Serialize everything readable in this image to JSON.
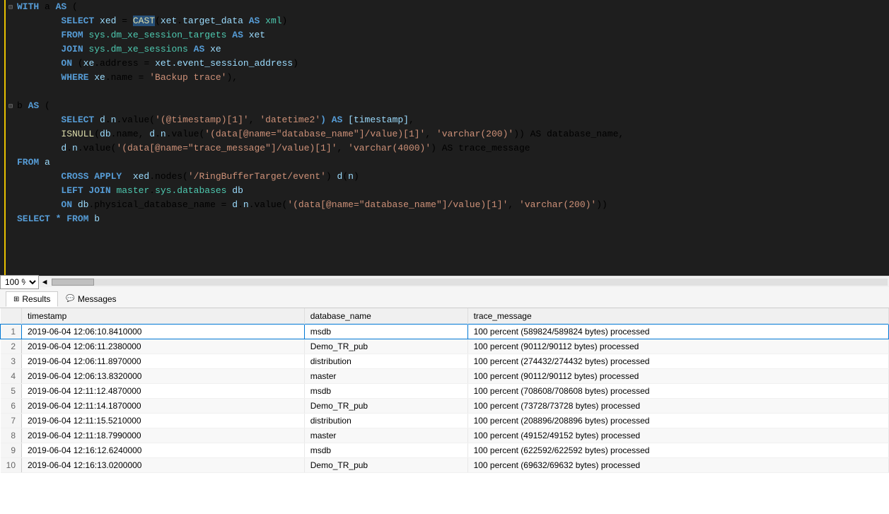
{
  "editor": {
    "lines": [
      {
        "num": "",
        "fold": "⊟",
        "content": [
          {
            "t": "WITH ",
            "c": "kw"
          },
          {
            "t": "a ",
            "c": ""
          },
          {
            "t": "AS ",
            "c": "kw"
          },
          {
            "t": "(",
            "c": ""
          }
        ]
      },
      {
        "num": "",
        "fold": "",
        "content": [
          {
            "t": "        SELECT ",
            "c": "kw"
          },
          {
            "t": "xed",
            "c": "col"
          },
          {
            "t": " = ",
            "c": ""
          },
          {
            "t": "CAST",
            "c": "fn highlight-cast"
          },
          {
            "t": "(",
            "c": ""
          },
          {
            "t": "xet",
            "c": "col"
          },
          {
            "t": ".",
            "c": ""
          },
          {
            "t": "target_data",
            "c": "col"
          },
          {
            "t": " AS ",
            "c": "kw"
          },
          {
            "t": "xml",
            "c": "type"
          },
          {
            "t": ")",
            "c": ""
          }
        ]
      },
      {
        "num": "",
        "fold": "",
        "content": [
          {
            "t": "        FROM ",
            "c": "kw"
          },
          {
            "t": "sys.dm_xe_session_targets",
            "c": "ident-green"
          },
          {
            "t": " AS ",
            "c": "kw"
          },
          {
            "t": "xet",
            "c": "col"
          }
        ]
      },
      {
        "num": "",
        "fold": "",
        "content": [
          {
            "t": "        JOIN ",
            "c": "kw"
          },
          {
            "t": "sys.dm_xe_sessions",
            "c": "ident-green"
          },
          {
            "t": " AS ",
            "c": "kw"
          },
          {
            "t": "xe",
            "c": "col"
          }
        ]
      },
      {
        "num": "",
        "fold": "",
        "content": [
          {
            "t": "        ON ",
            "c": "kw"
          },
          {
            "t": "(",
            "c": ""
          },
          {
            "t": "xe",
            "c": "col"
          },
          {
            "t": ".address = ",
            "c": ""
          },
          {
            "t": "xet",
            "c": "col"
          },
          {
            "t": ".event_session_address",
            "c": "col"
          },
          {
            "t": ")",
            "c": ""
          }
        ]
      },
      {
        "num": "",
        "fold": "",
        "content": [
          {
            "t": "        WHERE ",
            "c": "kw"
          },
          {
            "t": "xe",
            "c": "col"
          },
          {
            "t": ".name = ",
            "c": ""
          },
          {
            "t": "'Backup trace'",
            "c": "str"
          },
          {
            "t": "),",
            "c": ""
          }
        ]
      },
      {
        "num": "",
        "fold": "",
        "content": []
      },
      {
        "num": "",
        "fold": "⊟",
        "content": [
          {
            "t": "b ",
            "c": ""
          },
          {
            "t": "AS ",
            "c": "kw"
          },
          {
            "t": "(",
            "c": ""
          }
        ]
      },
      {
        "num": "",
        "fold": "",
        "content": [
          {
            "t": "        SELECT ",
            "c": "kw"
          },
          {
            "t": "d",
            "c": "col"
          },
          {
            "t": ".",
            "c": ""
          },
          {
            "t": "n",
            "c": "col"
          },
          {
            "t": ".value(",
            "c": ""
          },
          {
            "t": "'(@timestamp)[1]'",
            "c": "str"
          },
          {
            "t": ", ",
            "c": ""
          },
          {
            "t": "'datetime2'",
            "c": "str"
          },
          {
            "t": ") AS ",
            "c": "kw"
          },
          {
            "t": "[timestamp]",
            "c": "col"
          },
          {
            "t": ",",
            "c": ""
          }
        ]
      },
      {
        "num": "",
        "fold": "",
        "content": [
          {
            "t": "        ISNULL",
            "c": "fn"
          },
          {
            "t": "(",
            "c": ""
          },
          {
            "t": "db",
            "c": "col"
          },
          {
            "t": ".name, ",
            "c": ""
          },
          {
            "t": "d",
            "c": "col"
          },
          {
            "t": ".",
            "c": ""
          },
          {
            "t": "n",
            "c": "col"
          },
          {
            "t": ".value(",
            "c": ""
          },
          {
            "t": "'(data[@name=\"database_name\"]/value)[1]'",
            "c": "str"
          },
          {
            "t": ", ",
            "c": ""
          },
          {
            "t": "'varchar(200)'",
            "c": "str"
          },
          {
            "t": ")) AS database_name,",
            "c": ""
          }
        ]
      },
      {
        "num": "",
        "fold": "",
        "content": [
          {
            "t": "        d",
            "c": "col"
          },
          {
            "t": ".",
            "c": ""
          },
          {
            "t": "n",
            "c": "col"
          },
          {
            "t": ".value(",
            "c": ""
          },
          {
            "t": "'(data[@name=\"trace_message\"]/value)[1]'",
            "c": "str"
          },
          {
            "t": ", ",
            "c": ""
          },
          {
            "t": "'varchar(4000)'",
            "c": "str"
          },
          {
            "t": ") AS trace_message",
            "c": ""
          }
        ]
      },
      {
        "num": "",
        "fold": "",
        "content": [
          {
            "t": "FROM ",
            "c": "kw"
          },
          {
            "t": "a",
            "c": "col"
          }
        ]
      },
      {
        "num": "",
        "fold": "",
        "content": [
          {
            "t": "        CROSS APPLY  ",
            "c": "kw"
          },
          {
            "t": "xed",
            "c": "col"
          },
          {
            "t": ".nodes(",
            "c": ""
          },
          {
            "t": "'/RingBufferTarget/event'",
            "c": "str"
          },
          {
            "t": ") ",
            "c": ""
          },
          {
            "t": "d",
            "c": "col"
          },
          {
            "t": "(",
            "c": ""
          },
          {
            "t": "n",
            "c": "col"
          },
          {
            "t": ")",
            "c": ""
          }
        ]
      },
      {
        "num": "",
        "fold": "",
        "content": [
          {
            "t": "        LEFT JOIN ",
            "c": "kw"
          },
          {
            "t": "master",
            "c": "ident-green"
          },
          {
            "t": ".",
            "c": ""
          },
          {
            "t": "sys.databases",
            "c": "ident-green"
          },
          {
            "t": " db",
            "c": "col"
          }
        ]
      },
      {
        "num": "",
        "fold": "",
        "content": [
          {
            "t": "        ON ",
            "c": "kw"
          },
          {
            "t": "db",
            "c": "col"
          },
          {
            "t": ".physical_database_name = ",
            "c": ""
          },
          {
            "t": "d",
            "c": "col"
          },
          {
            "t": ".",
            "c": ""
          },
          {
            "t": "n",
            "c": "col"
          },
          {
            "t": ".value(",
            "c": ""
          },
          {
            "t": "'(data[@name=\"database_name\"]/value)[1]'",
            "c": "str"
          },
          {
            "t": ", ",
            "c": ""
          },
          {
            "t": "'varchar(200)'",
            "c": "str"
          },
          {
            "t": "))",
            "c": ""
          }
        ]
      },
      {
        "num": "",
        "fold": "",
        "content": [
          {
            "t": "SELECT ",
            "c": "kw"
          },
          {
            "t": "* FROM ",
            "c": "kw"
          },
          {
            "t": "b",
            "c": "col"
          }
        ]
      }
    ],
    "zoom": "100 %"
  },
  "tabs": {
    "results_label": "Results",
    "messages_label": "Messages"
  },
  "table": {
    "columns": [
      "",
      "timestamp",
      "database_name",
      "trace_message"
    ],
    "rows": [
      {
        "num": "1",
        "timestamp": "2019-06-04 12:06:10.8410000",
        "database_name": "msdb",
        "trace_message": "100 percent (589824/589824 bytes) processed"
      },
      {
        "num": "2",
        "timestamp": "2019-06-04 12:06:11.2380000",
        "database_name": "Demo_TR_pub",
        "trace_message": "100 percent (90112/90112 bytes) processed"
      },
      {
        "num": "3",
        "timestamp": "2019-06-04 12:06:11.8970000",
        "database_name": "distribution",
        "trace_message": "100 percent (274432/274432 bytes) processed"
      },
      {
        "num": "4",
        "timestamp": "2019-06-04 12:06:13.8320000",
        "database_name": "master",
        "trace_message": "100 percent (90112/90112 bytes) processed"
      },
      {
        "num": "5",
        "timestamp": "2019-06-04 12:11:12.4870000",
        "database_name": "msdb",
        "trace_message": "100 percent (708608/708608 bytes) processed"
      },
      {
        "num": "6",
        "timestamp": "2019-06-04 12:11:14.1870000",
        "database_name": "Demo_TR_pub",
        "trace_message": "100 percent (73728/73728 bytes) processed"
      },
      {
        "num": "7",
        "timestamp": "2019-06-04 12:11:15.5210000",
        "database_name": "distribution",
        "trace_message": "100 percent (208896/208896 bytes) processed"
      },
      {
        "num": "8",
        "timestamp": "2019-06-04 12:11:18.7990000",
        "database_name": "master",
        "trace_message": "100 percent (49152/49152 bytes) processed"
      },
      {
        "num": "9",
        "timestamp": "2019-06-04 12:16:12.6240000",
        "database_name": "msdb",
        "trace_message": "100 percent (622592/622592 bytes) processed"
      },
      {
        "num": "10",
        "timestamp": "2019-06-04 12:16:13.0200000",
        "database_name": "Demo_TR_pub",
        "trace_message": "100 percent (69632/69632 bytes) processed"
      }
    ]
  }
}
